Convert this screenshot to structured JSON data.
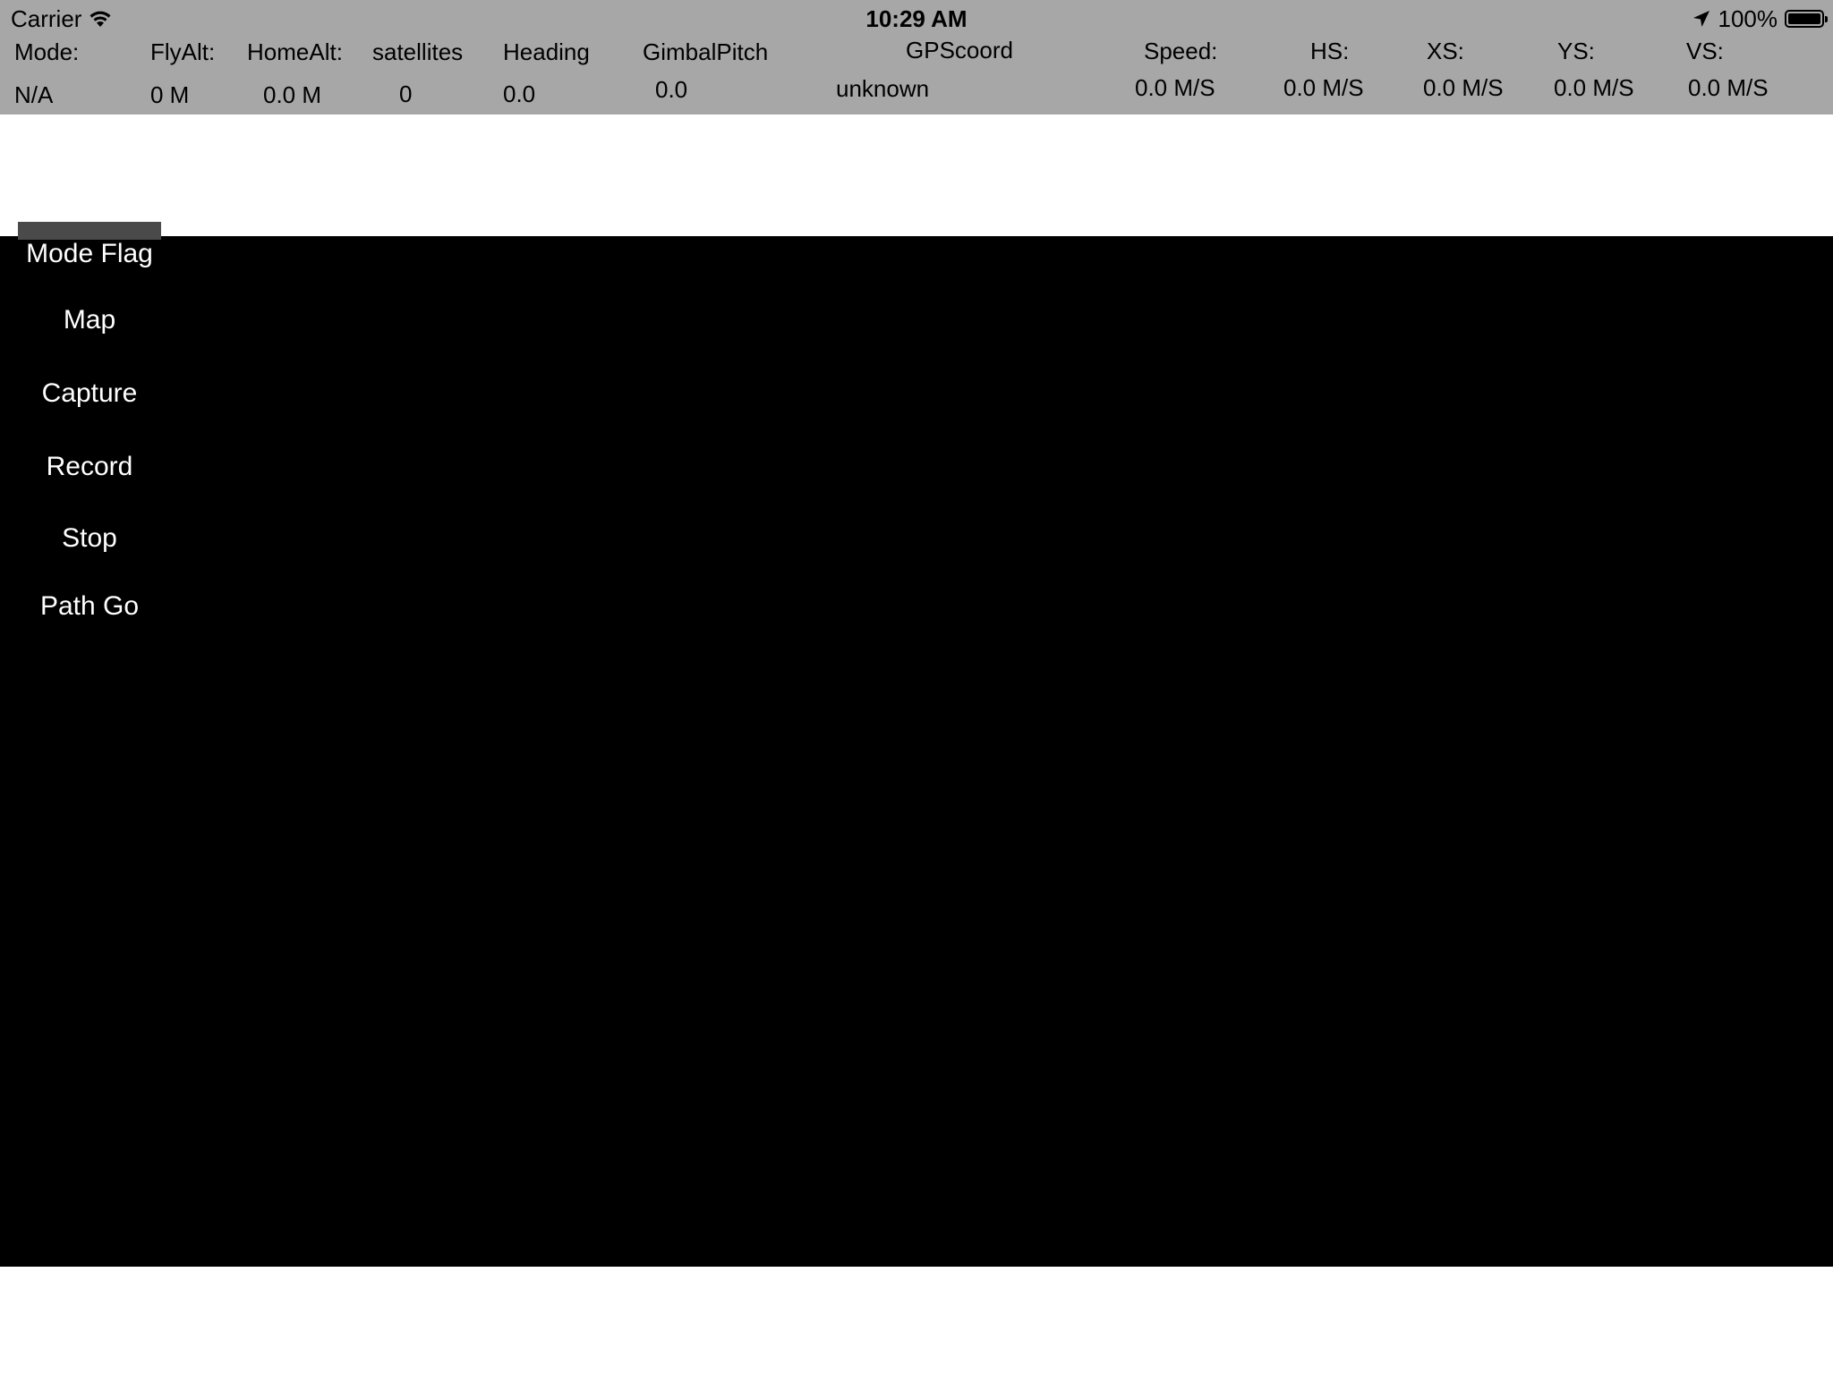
{
  "status_bar": {
    "carrier": "Carrier",
    "time": "10:29 AM",
    "battery_percent": "100%",
    "battery_level": 1.0,
    "icons": [
      "wifi-icon",
      "location-arrow-icon",
      "battery-icon"
    ]
  },
  "telemetry": {
    "mode": {
      "label": "Mode:",
      "value": "N/A"
    },
    "fly_alt": {
      "label": "FlyAlt:",
      "value": "0 M"
    },
    "home_alt": {
      "label": "HomeAlt:",
      "value": "0.0 M"
    },
    "satellites": {
      "label": "satellites",
      "value": "0"
    },
    "heading": {
      "label": "Heading",
      "value": "0.0"
    },
    "gimbal_pitch": {
      "label": "GimbalPitch",
      "value": "0.0"
    },
    "gps_coord": {
      "label": "GPScoord",
      "value": "unknown"
    },
    "speed": {
      "label": "Speed:",
      "value": "0.0 M/S"
    },
    "hs": {
      "label": "HS:",
      "value": "0.0 M/S"
    },
    "xs": {
      "label": "XS:",
      "value": "0.0 M/S"
    },
    "ys": {
      "label": "YS:",
      "value": "0.0 M/S"
    },
    "vs": {
      "label": "VS:",
      "value": "0.0 M/S"
    }
  },
  "side_menu": {
    "mode_flag": "Mode Flag",
    "map": "Map",
    "capture": "Capture",
    "record": "Record",
    "stop": "Stop",
    "path_go": "Path Go"
  },
  "colors": {
    "header_bg": "#a7a7a7",
    "video_bg": "#000000",
    "menu_text": "#ffffff",
    "tab_dark": "#4a4a4a"
  }
}
